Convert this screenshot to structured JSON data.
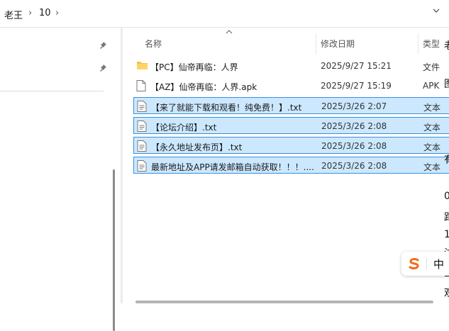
{
  "breadcrumb": {
    "items": [
      "老王",
      "10"
    ],
    "separator": "›"
  },
  "columns": {
    "name": "名称",
    "date": "修改日期",
    "type": "类型"
  },
  "files": [
    {
      "icon": "folder-icon",
      "name": "【PC】仙帝再临：人界",
      "date": "2025/9/27 15:21",
      "type": "文件",
      "selected": false
    },
    {
      "icon": "file-icon",
      "name": "【AZ】仙帝再临：人界.apk",
      "date": "2025/9/27 15:19",
      "type": "APK",
      "selected": false
    },
    {
      "icon": "text-file-icon",
      "name": "【来了就能下载和观看！纯免费！】.txt",
      "date": "2025/3/26 2:07",
      "type": "文本",
      "selected": true
    },
    {
      "icon": "text-file-icon",
      "name": "【论坛介绍】.txt",
      "date": "2025/3/26 2:08",
      "type": "文本",
      "selected": true
    },
    {
      "icon": "text-file-icon",
      "name": "【永久地址发布页】.txt",
      "date": "2025/3/26 2:08",
      "type": "文本",
      "selected": true
    },
    {
      "icon": "text-file-icon",
      "name": "最新地址及APP请发邮箱自动获取！！！....",
      "date": "2025/3/26 2:08",
      "type": "文本",
      "selected": true
    }
  ],
  "ime": {
    "mode_label": "中"
  },
  "edge_chars": [
    "老",
    "图",
    "有",
    "0",
    "距",
    "1",
    "注",
    "2",
    "观"
  ],
  "colors": {
    "selection": "#cce8ff",
    "selection_border": "#3b8edb",
    "folder": "#f2c14e",
    "ime_logo": "#f26a1b"
  }
}
